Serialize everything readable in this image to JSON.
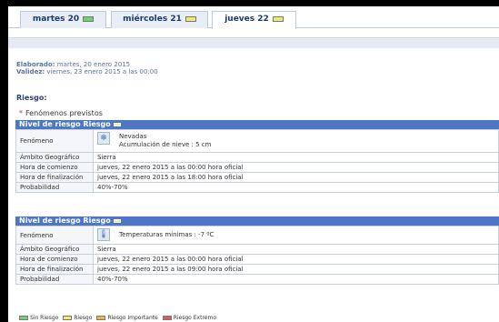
{
  "tabs": [
    {
      "label": "martes 20",
      "color": "#6fd46f",
      "active": false
    },
    {
      "label": "miércoles 21",
      "color": "#f0ec6a",
      "active": false
    },
    {
      "label": "jueves 22",
      "color": "#f0ec6a",
      "active": true
    }
  ],
  "meta": {
    "elaborado_label": "Elaborado:",
    "elaborado_value": " martes, 20 enero 2015",
    "validez_label": "Validez:",
    "validez_value": " viernes, 23 enero 2015 a las 00:00"
  },
  "riesgo": {
    "heading": "Riesgo:",
    "fenomenos_previstos": "Fenómenos previstos"
  },
  "blocks": [
    {
      "header": "Nivel de riesgo Riesgo",
      "header_swatch": "#f7f38a",
      "rows": {
        "fenomeno_key": "Fenómeno",
        "fenomeno_line1": "Nevadas",
        "fenomeno_line2": "Acumulación de nieve : 5 cm",
        "ambito_key": "Ámbito Geográfico",
        "ambito_val": "Sierra",
        "comienzo_key": "Hora de comienzo",
        "comienzo_val": "jueves, 22 enero 2015 a las 00:00 hora oficial",
        "fin_key": "Hora de finalización",
        "fin_val": "jueves, 22 enero 2015 a las 18:00 hora oficial",
        "prob_key": "Probabilidad",
        "prob_val": "40%-70%"
      },
      "icon": "snowflake-icon"
    },
    {
      "header": "Nivel de riesgo Riesgo",
      "header_swatch": "#f7f38a",
      "rows": {
        "fenomeno_key": "Fenómeno",
        "fenomeno_line1": "Temperaturas mínimas : -7 ºC",
        "ambito_key": "Ámbito Geográfico",
        "ambito_val": "Sierra",
        "comienzo_key": "Hora de comienzo",
        "comienzo_val": "jueves, 22 enero 2015 a las 00:00 hora oficial",
        "fin_key": "Hora de finalización",
        "fin_val": "jueves, 22 enero 2015 a las 09:00 hora oficial",
        "prob_key": "Probabilidad",
        "prob_val": "40%-70%"
      },
      "icon": "thermometer-icon"
    }
  ],
  "legend": [
    {
      "label": "Sin Riesgo",
      "color": "#6fd46f"
    },
    {
      "label": "Riesgo",
      "color": "#f0ec6a"
    },
    {
      "label": "Riesgo Importante",
      "color": "#f0b93a"
    },
    {
      "label": "Riesgo Extremo",
      "color": "#e05a5a"
    }
  ]
}
